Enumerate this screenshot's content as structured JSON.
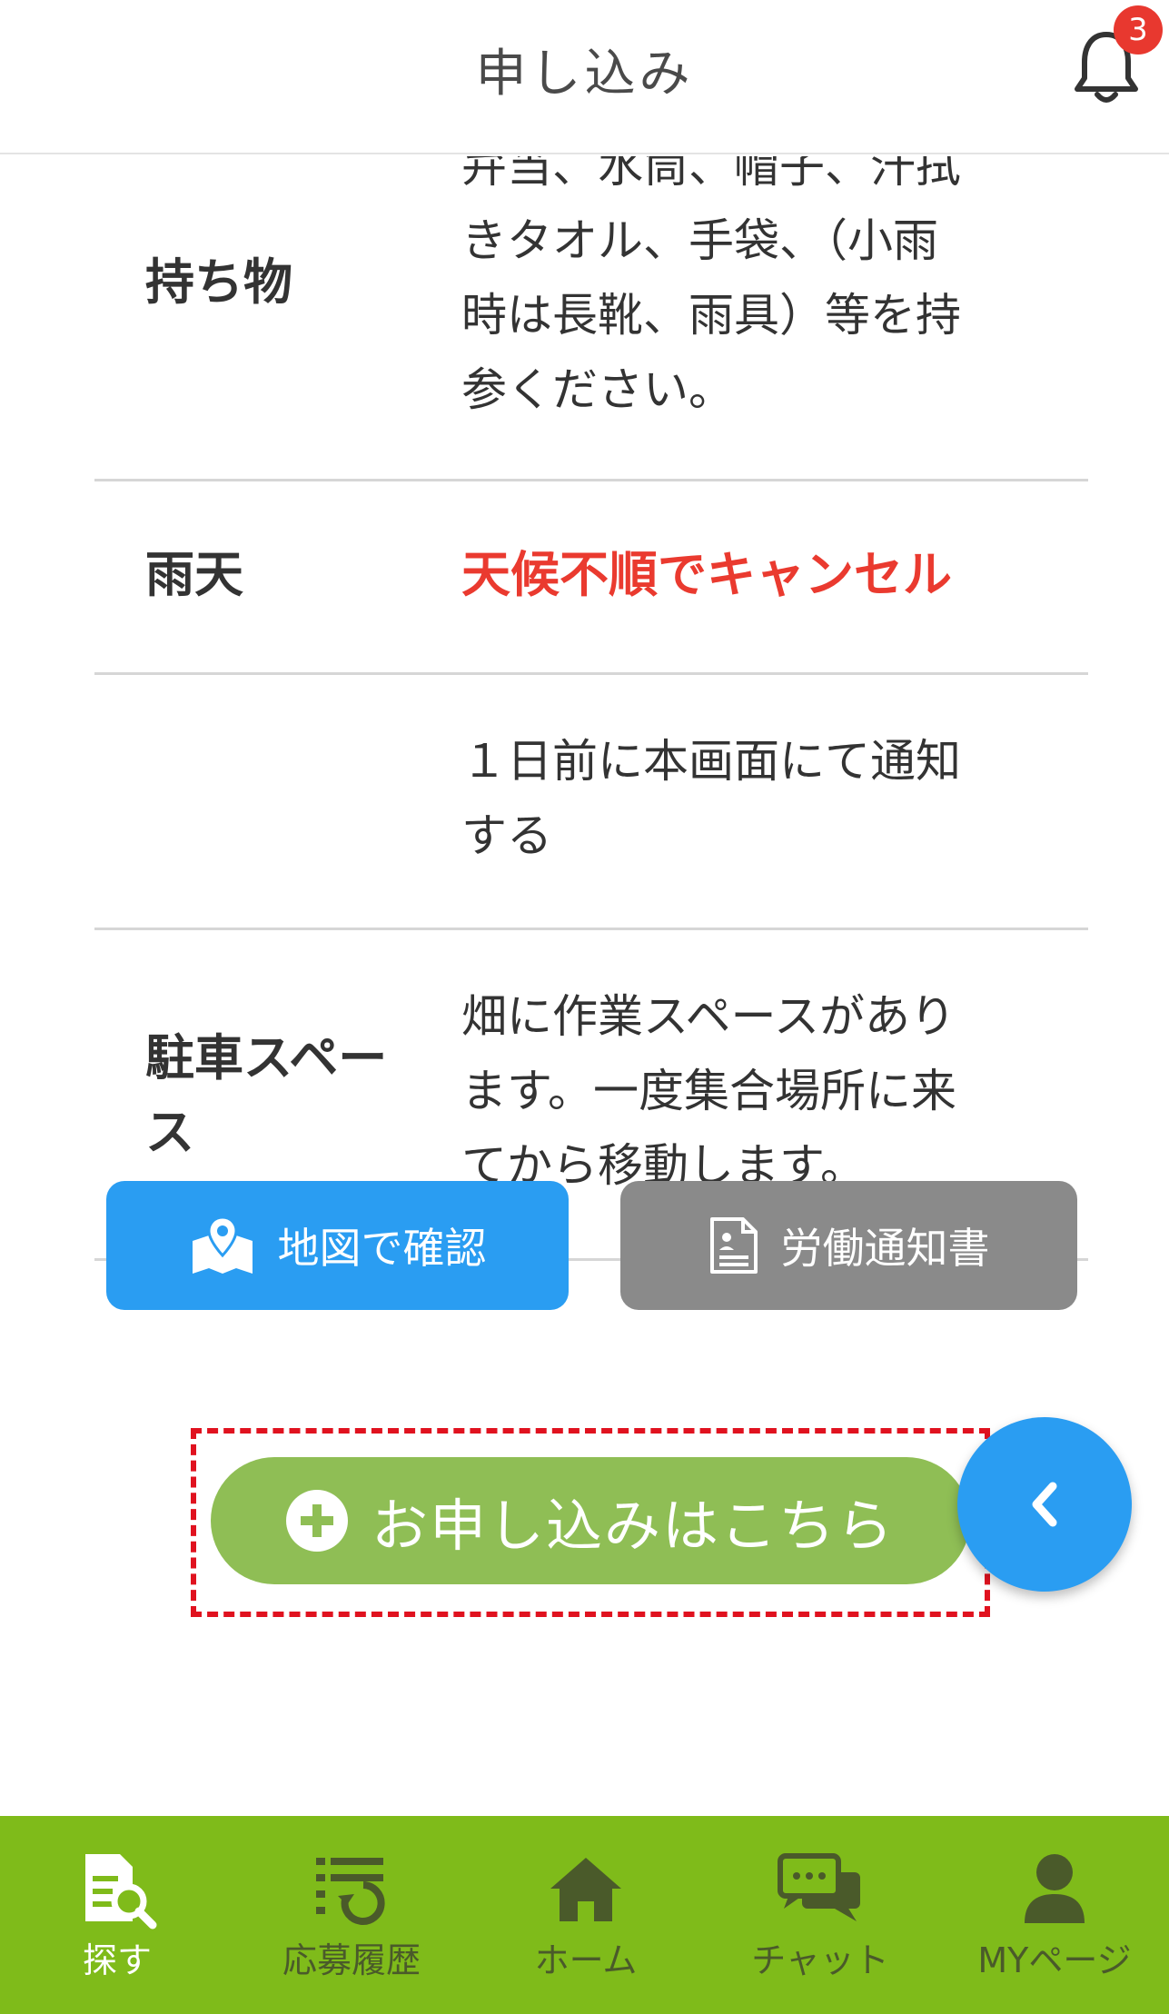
{
  "header": {
    "title": "申し込み",
    "notification_count": "3"
  },
  "details": {
    "items": {
      "label": "持ち物",
      "value_lines": [
        "弁当、水筒、帽子、汗拭",
        "きタオル、手袋、（小雨",
        "時は長靴、雨具）等を持",
        "参ください。"
      ]
    },
    "rain": {
      "label": "雨天",
      "value": "天候不順でキャンセル"
    },
    "notice": {
      "label": "",
      "value_lines": [
        "１日前に本画面にて通知",
        "する"
      ]
    },
    "parking": {
      "label_lines": [
        "駐車スペー",
        "ス"
      ],
      "value_lines": [
        "畑に作業スペースがあり",
        "ます。一度集合場所に来",
        "てから移動します。"
      ]
    }
  },
  "actions": {
    "map_label": "地図で確認",
    "doc_label": "労働通知書",
    "apply_label": "お申し込みはこちら"
  },
  "tabbar": {
    "tabs": [
      {
        "label": "探す",
        "icon": "search-document-icon",
        "active": true
      },
      {
        "label": "応募履歴",
        "icon": "history-list-icon",
        "active": false
      },
      {
        "label": "ホーム",
        "icon": "home-icon",
        "active": false
      },
      {
        "label": "チャット",
        "icon": "chat-icon",
        "active": false
      },
      {
        "label": "MYページ",
        "icon": "user-icon",
        "active": false
      }
    ]
  },
  "colors": {
    "accent_blue": "#2a9df2",
    "tab_green": "#7fbb1a",
    "apply_green": "#8fbe55",
    "alert_red": "#ea3a2f",
    "neutral_gray": "#8a8a8a"
  }
}
